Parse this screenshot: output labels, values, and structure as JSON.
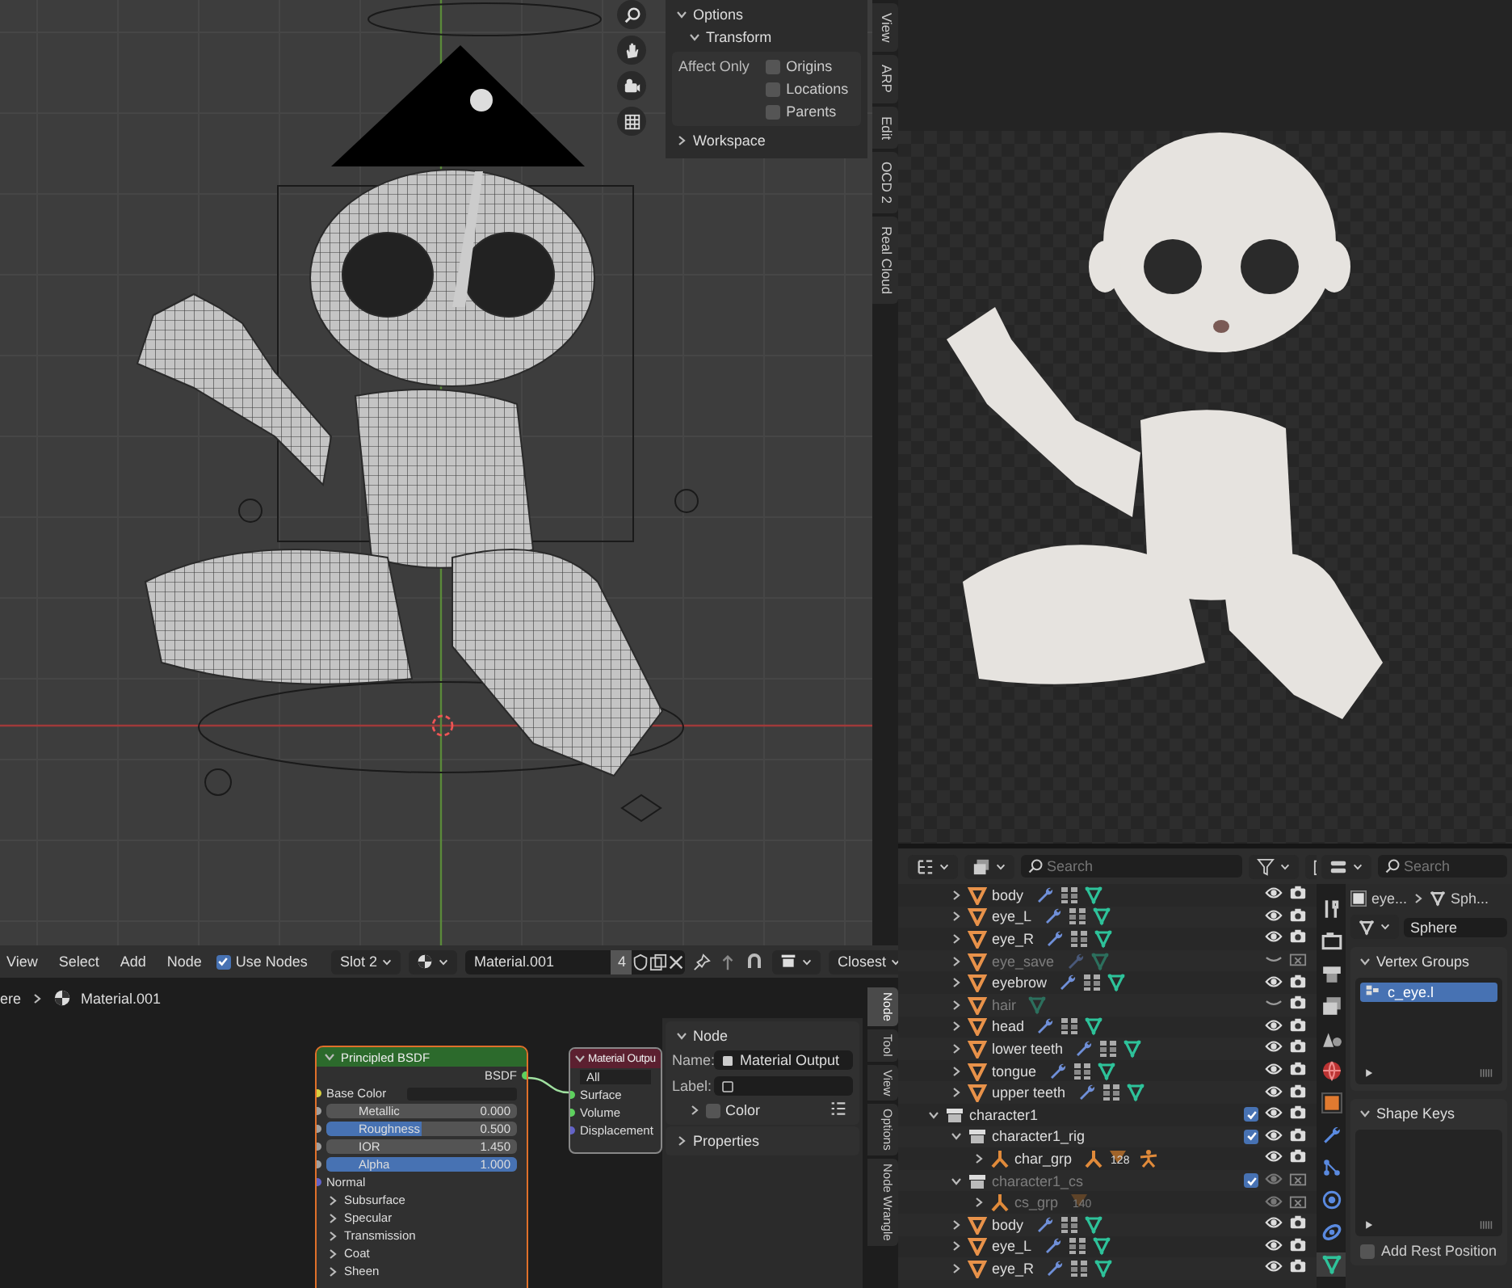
{
  "viewport": {
    "sidebar": {
      "options_label": "Options",
      "transform_label": "Transform",
      "affect_only_label": "Affect Only",
      "affect_only": [
        {
          "label": "Origins",
          "checked": false
        },
        {
          "label": "Locations",
          "checked": false
        },
        {
          "label": "Parents",
          "checked": false
        }
      ],
      "workspace_label": "Workspace"
    },
    "side_tabs": [
      {
        "label": "View",
        "selected": false
      },
      {
        "label": "ARP",
        "selected": false
      },
      {
        "label": "Edit",
        "selected": false
      },
      {
        "label": "OCD 2",
        "selected": false
      },
      {
        "label": "Real Cloud",
        "selected": false
      }
    ]
  },
  "node_editor": {
    "menu": [
      "View",
      "Select",
      "Add",
      "Node"
    ],
    "use_nodes": {
      "label": "Use Nodes",
      "checked": true
    },
    "slot": "Slot 2",
    "material": "Material.001",
    "users": "4",
    "snap": "Closest",
    "breadcrumb": [
      "ere",
      "Material.001"
    ],
    "principled": {
      "title": "Principled BSDF",
      "output": "BSDF",
      "inputs": [
        {
          "kind": "color",
          "label": "Base Color"
        },
        {
          "kind": "number",
          "label": "Metallic",
          "value": "0.000"
        },
        {
          "kind": "slider",
          "label": "Roughness",
          "value": "0.500",
          "level": 0.5
        },
        {
          "kind": "number",
          "label": "IOR",
          "value": "1.450"
        },
        {
          "kind": "slider",
          "label": "Alpha",
          "value": "1.000",
          "level": 1
        },
        {
          "kind": "socket",
          "label": "Normal"
        }
      ],
      "panels": [
        "Subsurface",
        "Specular",
        "Transmission",
        "Coat",
        "Sheen"
      ]
    },
    "output": {
      "title": "Material Outpu",
      "target": "All",
      "inputs": [
        "Surface",
        "Volume",
        "Displacement"
      ]
    },
    "sidebar": {
      "node_label": "Node",
      "name_label": "Name:",
      "name_value": "Material Output",
      "label_label": "Label:",
      "color_label": "Color",
      "color_checked": false,
      "properties_label": "Properties"
    },
    "tabs": [
      {
        "label": "Node",
        "selected": true
      },
      {
        "label": "Tool",
        "selected": false
      },
      {
        "label": "View",
        "selected": false
      },
      {
        "label": "Options",
        "selected": false
      },
      {
        "label": "Node Wrangle",
        "selected": false
      }
    ]
  },
  "outliner": {
    "search_placeholder": "Search",
    "continued_rows": [
      {
        "name": "body",
        "kind": "mesh",
        "expanded": false,
        "excluded": false,
        "hidden": false,
        "render_disabled": false,
        "icons": [
          {
            "kind": "modifier"
          },
          {
            "kind": "vertex-groups"
          },
          {
            "kind": "mesh"
          }
        ]
      },
      {
        "name": "eye_L",
        "kind": "mesh",
        "expanded": false,
        "excluded": false,
        "hidden": false,
        "render_disabled": false,
        "icons": [
          {
            "kind": "modifier"
          },
          {
            "kind": "vertex-groups"
          },
          {
            "kind": "mesh"
          }
        ]
      },
      {
        "name": "eye_R",
        "kind": "mesh",
        "expanded": false,
        "excluded": false,
        "hidden": false,
        "render_disabled": false,
        "icons": [
          {
            "kind": "modifier"
          },
          {
            "kind": "vertex-groups"
          },
          {
            "kind": "mesh"
          }
        ]
      },
      {
        "name": "eye_save",
        "kind": "mesh",
        "expanded": false,
        "excluded": true,
        "hidden": true,
        "render_disabled": true,
        "icons": [
          {
            "kind": "modifier"
          },
          {
            "kind": "mesh"
          }
        ]
      },
      {
        "name": "eyebrow",
        "kind": "mesh",
        "expanded": false,
        "excluded": false,
        "hidden": false,
        "render_disabled": false,
        "icons": [
          {
            "kind": "modifier"
          },
          {
            "kind": "vertex-groups"
          },
          {
            "kind": "mesh"
          }
        ]
      },
      {
        "name": "hair",
        "kind": "mesh",
        "expanded": false,
        "excluded": true,
        "hidden": true,
        "render_disabled": false,
        "icons": [
          {
            "kind": "mesh"
          }
        ]
      },
      {
        "name": "head",
        "kind": "mesh",
        "expanded": false,
        "excluded": false,
        "hidden": false,
        "render_disabled": false,
        "icons": [
          {
            "kind": "modifier"
          },
          {
            "kind": "vertex-groups"
          },
          {
            "kind": "mesh"
          }
        ]
      },
      {
        "name": "lower teeth",
        "kind": "mesh",
        "expanded": false,
        "excluded": false,
        "hidden": false,
        "render_disabled": false,
        "icons": [
          {
            "kind": "modifier"
          },
          {
            "kind": "vertex-groups"
          },
          {
            "kind": "mesh"
          }
        ]
      },
      {
        "name": "tongue",
        "kind": "mesh",
        "expanded": false,
        "excluded": false,
        "hidden": false,
        "render_disabled": false,
        "icons": [
          {
            "kind": "modifier"
          },
          {
            "kind": "vertex-groups"
          },
          {
            "kind": "mesh"
          }
        ]
      },
      {
        "name": "upper teeth",
        "kind": "mesh",
        "expanded": false,
        "excluded": false,
        "hidden": false,
        "render_disabled": false,
        "icons": [
          {
            "kind": "modifier"
          },
          {
            "kind": "vertex-groups"
          },
          {
            "kind": "mesh"
          }
        ]
      }
    ],
    "rows": [
      {
        "name": "character1",
        "kind": "collection",
        "checked": true,
        "expanded": true,
        "excluded": false,
        "hidden": false,
        "render_disabled": false,
        "children": [
          {
            "name": "character1_rig",
            "kind": "collection",
            "checked": true,
            "expanded": true,
            "excluded": false,
            "hidden": false,
            "render_disabled": false,
            "children": [
              {
                "name": "char_grp",
                "kind": "armature",
                "expanded": false,
                "excluded": false,
                "hidden": false,
                "render_disabled": false,
                "icons": [
                  {
                    "kind": "armature"
                  },
                  {
                    "kind": "armature-data",
                    "count": "128"
                  },
                  {
                    "kind": "pose"
                  }
                ]
              }
            ]
          },
          {
            "name": "character1_cs",
            "kind": "collection",
            "checked": true,
            "expanded": true,
            "excluded": true,
            "hidden": false,
            "render_disabled": true,
            "children": [
              {
                "name": "cs_grp",
                "kind": "armature",
                "expanded": false,
                "excluded": true,
                "hidden": false,
                "render_disabled": true,
                "icons": [
                  {
                    "kind": "armature-data",
                    "count": "140"
                  }
                ]
              }
            ]
          },
          {
            "name": "body",
            "kind": "mesh",
            "expanded": false,
            "excluded": false,
            "hidden": false,
            "render_disabled": false,
            "icons": [
              {
                "kind": "modifier"
              },
              {
                "kind": "vertex-groups"
              },
              {
                "kind": "mesh"
              }
            ]
          },
          {
            "name": "eye_L",
            "kind": "mesh",
            "expanded": false,
            "excluded": false,
            "hidden": false,
            "render_disabled": false,
            "icons": [
              {
                "kind": "modifier"
              },
              {
                "kind": "vertex-groups"
              },
              {
                "kind": "mesh"
              }
            ]
          },
          {
            "name": "eye_R",
            "kind": "mesh",
            "expanded": false,
            "excluded": false,
            "hidden": false,
            "render_disabled": false,
            "icons": [
              {
                "kind": "modifier"
              },
              {
                "kind": "vertex-groups"
              },
              {
                "kind": "mesh"
              }
            ]
          }
        ]
      }
    ]
  },
  "properties": {
    "search_placeholder": "Search",
    "tabs": [
      {
        "kind": "tool",
        "selected": false
      },
      {
        "kind": "render",
        "selected": false
      },
      {
        "kind": "output",
        "selected": false
      },
      {
        "kind": "view-layer",
        "selected": false
      },
      {
        "kind": "scene",
        "selected": false
      },
      {
        "kind": "world",
        "selected": false
      },
      {
        "kind": "object",
        "selected": false
      },
      {
        "kind": "modifier",
        "selected": false
      },
      {
        "kind": "particles",
        "selected": false
      },
      {
        "kind": "physics",
        "selected": false
      },
      {
        "kind": "constraints",
        "selected": false
      },
      {
        "kind": "data",
        "selected": true
      }
    ],
    "breadcrumb": [
      "eye...",
      "Sph..."
    ],
    "data_name": "Sphere",
    "vertex_groups": {
      "title": "Vertex Groups",
      "items": [
        {
          "name": "c_eye.l",
          "selected": true
        }
      ]
    },
    "shape_keys": {
      "title": "Shape Keys"
    },
    "add_rest_position": {
      "label": "Add Rest Position",
      "checked": false
    }
  }
}
